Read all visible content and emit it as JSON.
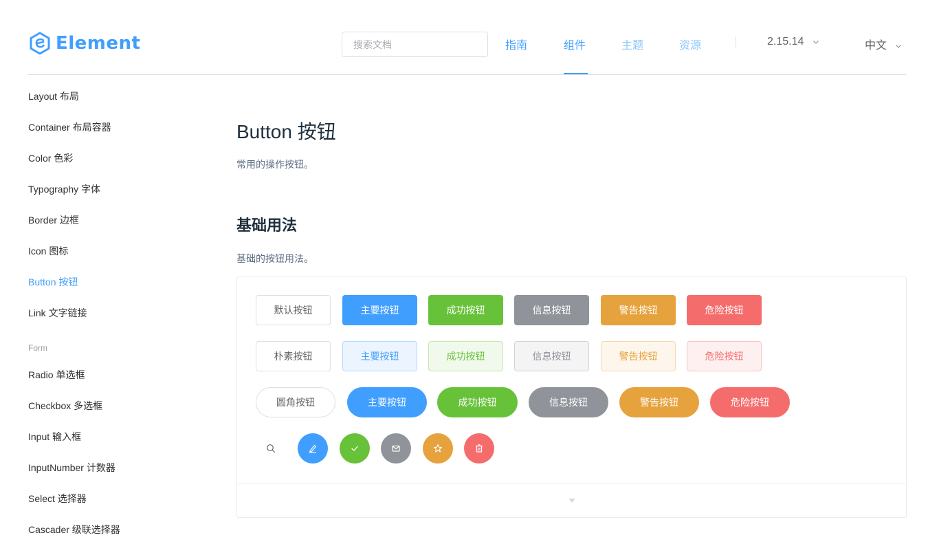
{
  "header": {
    "logo_text": "Element",
    "search_placeholder": "搜索文档",
    "nav": {
      "guide": "指南",
      "component": "组件",
      "theme": "主题",
      "resource": "资源"
    },
    "version": "2.15.14",
    "language": "中文"
  },
  "sidebar": {
    "items": [
      "Layout 布局",
      "Container 布局容器",
      "Color 色彩",
      "Typography 字体",
      "Border 边框",
      "Icon 图标",
      "Button 按钮",
      "Link 文字链接"
    ],
    "form_group": "Form",
    "form_items": [
      "Radio 单选框",
      "Checkbox 多选框",
      "Input 输入框",
      "InputNumber 计数器",
      "Select 选择器",
      "Cascader 级联选择器"
    ],
    "active_item": "Button 按钮"
  },
  "main": {
    "title": "Button 按钮",
    "description": "常用的操作按钮。",
    "section_title": "基础用法",
    "section_description": "基础的按钮用法。"
  },
  "buttons": {
    "row1": [
      "默认按钮",
      "主要按钮",
      "成功按钮",
      "信息按钮",
      "警告按钮",
      "危险按钮"
    ],
    "row2": [
      "朴素按钮",
      "主要按钮",
      "成功按钮",
      "信息按钮",
      "警告按钮",
      "危险按钮"
    ],
    "row3": [
      "圆角按钮",
      "主要按钮",
      "成功按钮",
      "信息按钮",
      "警告按钮",
      "危险按钮"
    ],
    "row4_icons": [
      "search-icon",
      "edit-icon",
      "check-icon",
      "message-icon",
      "star-icon",
      "delete-icon"
    ]
  },
  "colors": {
    "primary": "#409eff",
    "success": "#67c23a",
    "info": "#909399",
    "warning": "#e6a23c",
    "danger": "#f56c6c"
  }
}
